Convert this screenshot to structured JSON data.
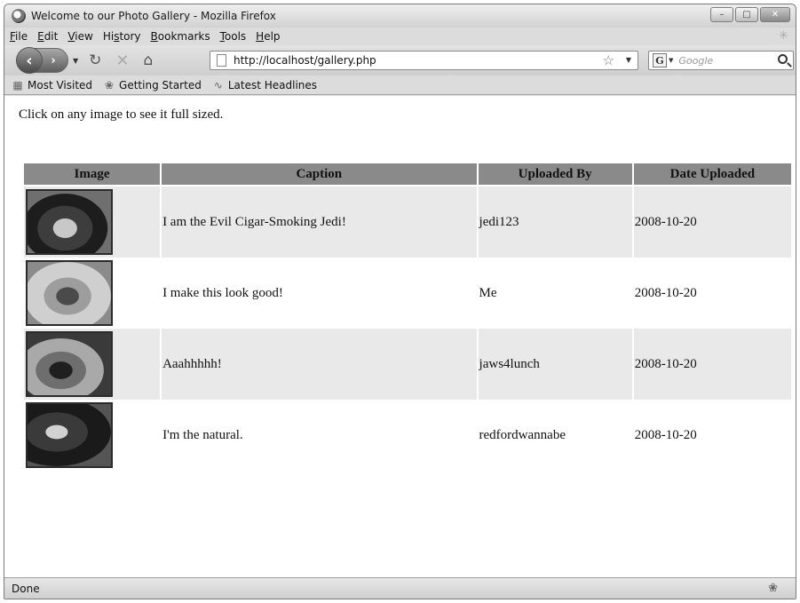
{
  "window": {
    "title": "Welcome to our Photo Gallery - Mozilla Firefox",
    "controls": {
      "minimize": "–",
      "maximize": "□",
      "close": "✕"
    }
  },
  "menu": [
    "File",
    "Edit",
    "View",
    "History",
    "Bookmarks",
    "Tools",
    "Help"
  ],
  "menu_mnemonics": [
    "F",
    "E",
    "V",
    "s",
    "B",
    "T",
    "H"
  ],
  "navigation": {
    "url": "http://localhost/gallery.php",
    "search_placeholder": "Google",
    "icons": {
      "back": "back-arrow-icon",
      "forward": "forward-arrow-icon",
      "reload": "reload-icon",
      "stop": "stop-icon",
      "home": "home-icon",
      "bookmark_star": "star-icon",
      "search_engine": "google-icon",
      "search": "search-icon"
    }
  },
  "bookmarks": [
    {
      "label": "Most Visited",
      "icon": "most-visited-icon"
    },
    {
      "label": "Getting Started",
      "icon": "getting-started-icon"
    },
    {
      "label": "Latest Headlines",
      "icon": "rss-feed-icon"
    }
  ],
  "page": {
    "intro": "Click on any image to see it full sized.",
    "table": {
      "headers": [
        "Image",
        "Caption",
        "Uploaded By",
        "Date Uploaded"
      ],
      "rows": [
        {
          "caption": "I am the Evil Cigar-Smoking Jedi!",
          "uploaded_by": "jedi123",
          "date": "2008-10-20"
        },
        {
          "caption": "I make this look good!",
          "uploaded_by": "Me",
          "date": "2008-10-20"
        },
        {
          "caption": "Aaahhhhh!",
          "uploaded_by": "jaws4lunch",
          "date": "2008-10-20"
        },
        {
          "caption": "I'm the natural.",
          "uploaded_by": "redfordwannabe",
          "date": "2008-10-20"
        }
      ]
    }
  },
  "status": {
    "text": "Done"
  },
  "colors": {
    "header_bg": "#8a8a8a",
    "shaded_row": "#e9e9e9"
  }
}
